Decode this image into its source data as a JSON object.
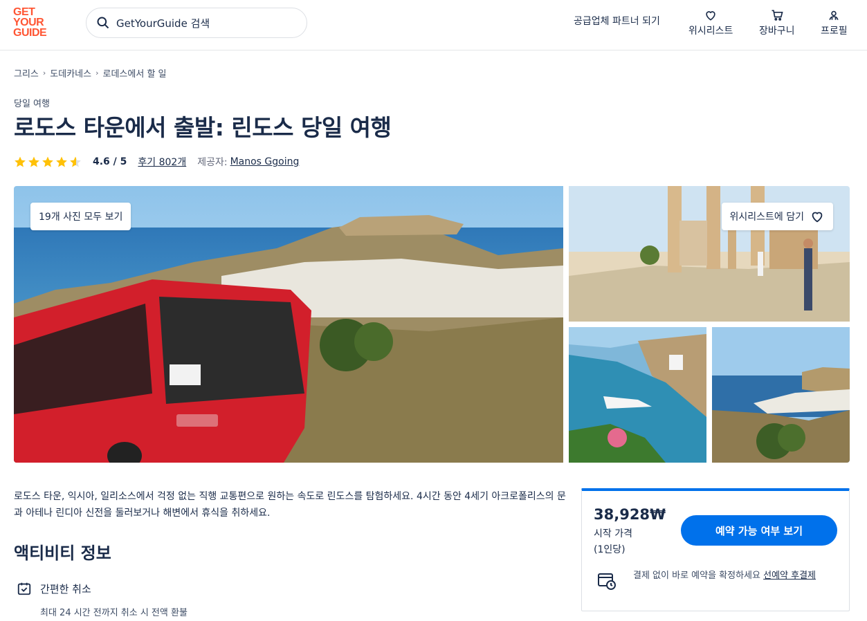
{
  "header": {
    "logo_lines": [
      "GET",
      "YOUR",
      "GUIDE"
    ],
    "search_placeholder": "GetYourGuide 검색",
    "partner_link": "공급업체 파트너 되기",
    "nav": {
      "wishlist": "위시리스트",
      "cart": "장바구니",
      "profile": "프로필"
    }
  },
  "breadcrumb": [
    "그리스",
    "도데카네스",
    "로데스에서 할 일"
  ],
  "activity": {
    "category": "당일 여행",
    "title": "로도스 타운에서 출발: 린도스 당일 여행",
    "rating_value": "4.6 / 5",
    "rating": 4.6,
    "reviews": "후기 802개",
    "provider_label": "제공자:",
    "provider": "Manos Ggoing"
  },
  "gallery": {
    "all_photos": "19개 사진 모두 보기",
    "wishlist_btn": "위시리스트에 담기"
  },
  "description": "로도스 타운, 익시아, 일리소스에서 걱정 없는 직행 교통편으로 원하는 속도로 린도스를 탐험하세요. 4시간 동안 4세기 아크로폴리스의 문과 아테나 린디아 신전을 둘러보거나 해변에서 휴식을 취하세요.",
  "info": {
    "section_title": "액티비티 정보",
    "feature_title": "간편한 취소",
    "feature_sub": "최대 24 시간 전까지 취소 시 전액 환불"
  },
  "booking": {
    "price": "38,928₩",
    "from": "시작 가격",
    "per": "(1인당)",
    "check_button": "예약 가능 여부 보기",
    "reserve_text": "결제 없이 바로 예약을 확정하세요 ",
    "reserve_link": "선예약 후결제"
  },
  "colors": {
    "brand": "#ff5533",
    "primary": "#0071eb",
    "text": "#1a2b49",
    "star": "#ffc107"
  }
}
